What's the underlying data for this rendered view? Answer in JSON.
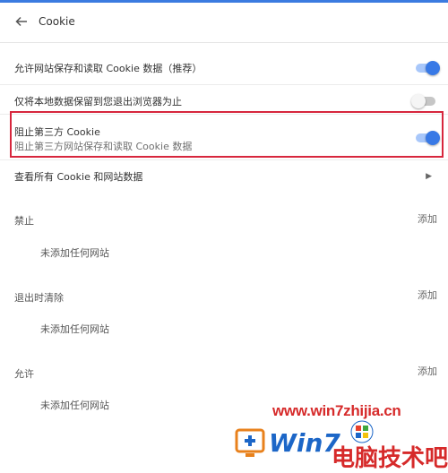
{
  "header": {
    "title": "Cookie"
  },
  "settings": {
    "allow_sites": {
      "label": "允许网站保存和读取 Cookie 数据（推荐）",
      "enabled": true
    },
    "keep_local": {
      "label": "仅将本地数据保留到您退出浏览器为止",
      "enabled": false
    },
    "block_third_party": {
      "label": "阻止第三方 Cookie",
      "description": "阻止第三方网站保存和读取 Cookie 数据",
      "enabled": true
    },
    "see_all": {
      "label": "查看所有 Cookie 和网站数据"
    }
  },
  "sections": [
    {
      "title": "禁止",
      "add_label": "添加",
      "empty_text": "未添加任何网站"
    },
    {
      "title": "退出时清除",
      "add_label": "添加",
      "empty_text": "未添加任何网站"
    },
    {
      "title": "允许",
      "add_label": "添加",
      "empty_text": "未添加任何网站"
    }
  ],
  "watermark": {
    "url": "www.win7zhijia.cn",
    "brand": "Win7",
    "slogan": "电脑技术吧"
  },
  "colors": {
    "accent": "#3879e6",
    "toggle_track_on": "#a8c7fa",
    "highlight": "#d7263d",
    "watermark": "#d62a2a"
  }
}
